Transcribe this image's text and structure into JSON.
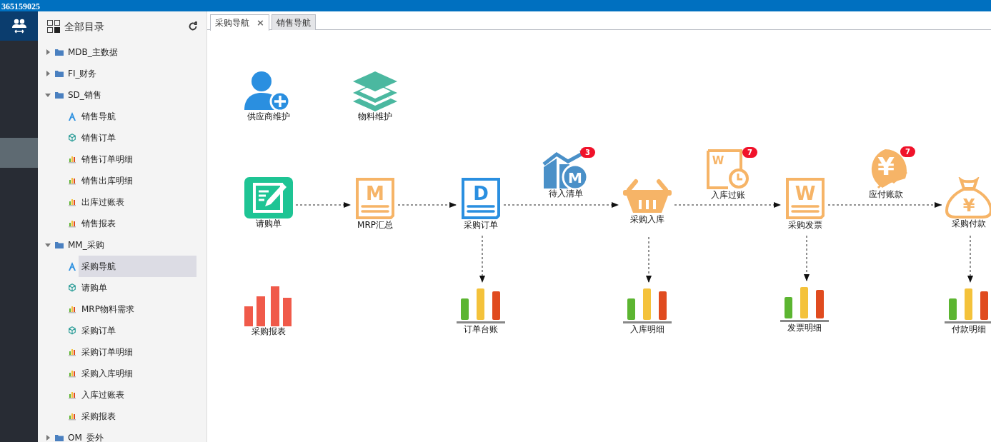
{
  "header": {
    "title": "365159025"
  },
  "sidebar": {
    "title": "全部目录",
    "tree": [
      {
        "label": "MDB_主数据",
        "expanded": false
      },
      {
        "label": "FI_财务",
        "expanded": false
      },
      {
        "label": "SD_销售",
        "expanded": true,
        "children": [
          {
            "label": "销售导航",
            "kind": "nav",
            "selected": false
          },
          {
            "label": "销售订单",
            "kind": "form",
            "selected": false
          },
          {
            "label": "销售订单明细",
            "kind": "report",
            "selected": false
          },
          {
            "label": "销售出库明细",
            "kind": "report",
            "selected": false
          },
          {
            "label": "出库过账表",
            "kind": "report",
            "selected": false
          },
          {
            "label": "销售报表",
            "kind": "report",
            "selected": false
          }
        ]
      },
      {
        "label": "MM_采购",
        "expanded": true,
        "children": [
          {
            "label": "采购导航",
            "kind": "nav",
            "selected": true
          },
          {
            "label": "请购单",
            "kind": "form",
            "selected": false
          },
          {
            "label": "MRP物料需求",
            "kind": "report",
            "selected": false
          },
          {
            "label": "采购订单",
            "kind": "form",
            "selected": false
          },
          {
            "label": "采购订单明细",
            "kind": "report",
            "selected": false
          },
          {
            "label": "采购入库明细",
            "kind": "report",
            "selected": false
          },
          {
            "label": "入库过账表",
            "kind": "report",
            "selected": false
          },
          {
            "label": "采购报表",
            "kind": "report",
            "selected": false
          }
        ]
      },
      {
        "label": "OM_委外",
        "expanded": false
      }
    ]
  },
  "tabs": [
    {
      "label": "采购导航",
      "selected": true,
      "close": "×"
    },
    {
      "label": "销售导航",
      "selected": false
    }
  ],
  "nodes": [
    {
      "label": "供应商维护",
      "kind": "user-add"
    },
    {
      "label": "物料维护",
      "kind": "layers"
    },
    {
      "label": "请购单",
      "kind": "form-edit"
    },
    {
      "label": "MRP汇总",
      "kind": "doc",
      "icon_letter": "M",
      "color": "#f6b467"
    },
    {
      "label": "采购订单",
      "kind": "doc",
      "icon_letter": "D",
      "color": "#2a8fe0"
    },
    {
      "label": "待入清单",
      "kind": "chart-up",
      "icon_letter": "M",
      "badge": "3"
    },
    {
      "label": "采购入库",
      "kind": "basket"
    },
    {
      "label": "入库过账",
      "kind": "doc-clock",
      "icon_letter": "W",
      "badge": "7"
    },
    {
      "label": "采购发票",
      "kind": "doc",
      "icon_letter": "W",
      "color": "#f6b467"
    },
    {
      "label": "应付账款",
      "kind": "yen-coin",
      "icon_letter": "¥",
      "badge": "7"
    },
    {
      "label": "采购付款",
      "kind": "money-bag",
      "icon_letter": "¥"
    },
    {
      "label": "采购报表",
      "kind": "red-bars"
    },
    {
      "label": "订单台账",
      "kind": "color-bars"
    },
    {
      "label": "入库明细",
      "kind": "color-bars"
    },
    {
      "label": "发票明细",
      "kind": "color-bars"
    },
    {
      "label": "付款明细",
      "kind": "color-bars"
    }
  ]
}
